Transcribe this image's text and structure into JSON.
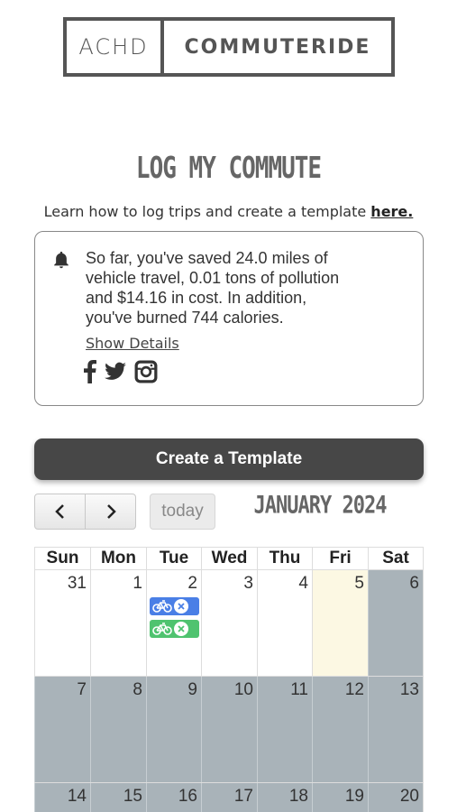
{
  "logo": {
    "left": "ACHD",
    "right": "COMMUTERIDE"
  },
  "page": {
    "title": "LOG MY COMMUTE",
    "subtitle_text": "Learn how to log trips and create a template ",
    "subtitle_link": "here."
  },
  "savings": {
    "line1": "So far, you've saved 24.0 miles of",
    "line2": "vehicle travel, 0.01 tons of pollution",
    "line3": "and $14.16 in cost. In addition,",
    "line4": "you've burned 744 calories.",
    "details_link": "Show Details",
    "social_icons": [
      "facebook-icon",
      "twitter-icon",
      "instagram-icon"
    ]
  },
  "create_button": "Create a Template",
  "calendar": {
    "today_label": "today",
    "month_title": "JANUARY 2024",
    "weekdays": [
      "Sun",
      "Mon",
      "Tue",
      "Wed",
      "Thu",
      "Fri",
      "Sat"
    ],
    "week1": [
      "31",
      "1",
      "2",
      "3",
      "4",
      "5",
      "6"
    ],
    "week2": [
      "7",
      "8",
      "9",
      "10",
      "11",
      "12",
      "13"
    ],
    "week3": [
      "14",
      "15",
      "16",
      "17",
      "18",
      "19",
      "20"
    ],
    "event_colors": {
      "blue": "#4a7fe6",
      "green": "#4fc36f"
    },
    "today_color": "#fcf8e3",
    "past_color": "#a9b3b9"
  }
}
